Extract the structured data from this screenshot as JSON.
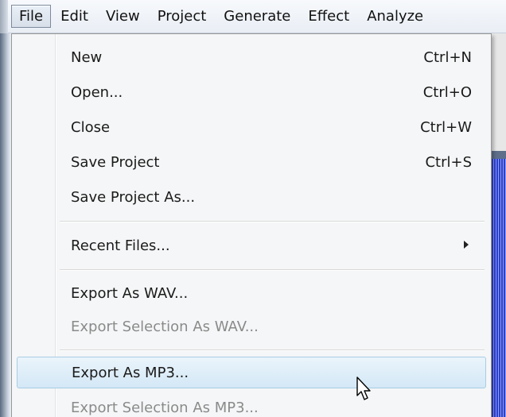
{
  "menubar": {
    "items": [
      "File",
      "Edit",
      "View",
      "Project",
      "Generate",
      "Effect",
      "Analyze"
    ]
  },
  "file_menu": {
    "items": [
      {
        "label": "New",
        "shortcut": "Ctrl+N",
        "enabled": true
      },
      {
        "label": "Open...",
        "shortcut": "Ctrl+O",
        "enabled": true
      },
      {
        "label": "Close",
        "shortcut": "Ctrl+W",
        "enabled": true
      },
      {
        "label": "Save Project",
        "shortcut": "Ctrl+S",
        "enabled": true
      },
      {
        "label": "Save Project As...",
        "shortcut": "",
        "enabled": true
      },
      {
        "label": "Recent Files...",
        "shortcut": "",
        "enabled": true,
        "submenu": true
      },
      {
        "label": "Export As WAV...",
        "shortcut": "",
        "enabled": true
      },
      {
        "label": "Export Selection As WAV...",
        "shortcut": "",
        "enabled": false
      },
      {
        "label": "Export As MP3...",
        "shortcut": "",
        "enabled": true,
        "highlighted": true
      },
      {
        "label": "Export Selection As MP3...",
        "shortcut": "",
        "enabled": false
      }
    ]
  },
  "icons": {
    "submenu": "chevron-right-icon",
    "pointer": "mouse-pointer-icon"
  },
  "colors": {
    "highlight": "#d4e8f6",
    "disabled_text": "#8a8a8a",
    "waveform": "#2d3fd0"
  }
}
